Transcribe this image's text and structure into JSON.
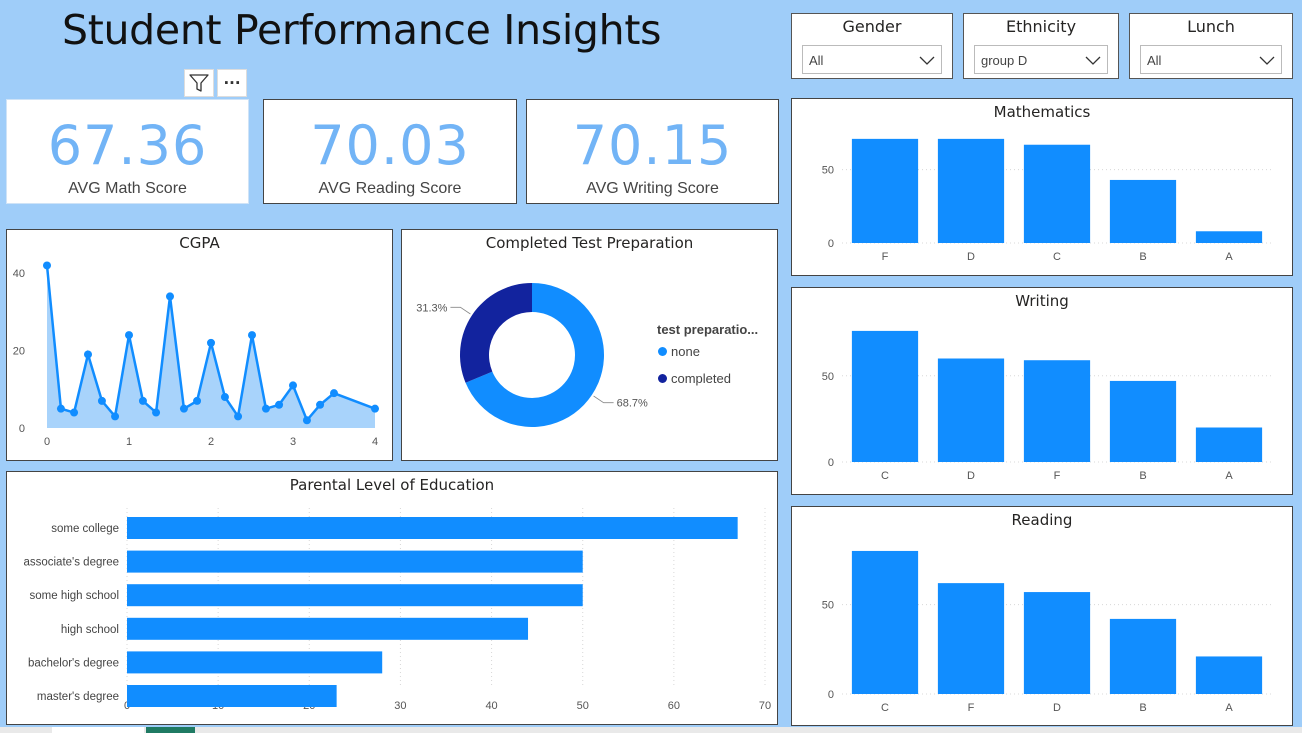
{
  "page": {
    "title": "Student Performance Insights"
  },
  "slicers": [
    {
      "label": "Gender",
      "value": "All"
    },
    {
      "label": "Ethnicity",
      "value": "group D"
    },
    {
      "label": "Lunch",
      "value": "All"
    }
  ],
  "visual_toolbar": {
    "filter_icon": "filter-icon",
    "more_icon": "more-options-icon",
    "more_glyph": "···"
  },
  "kpis": [
    {
      "value": "67.36",
      "label": "AVG Math Score"
    },
    {
      "value": "70.03",
      "label": "AVG Reading Score"
    },
    {
      "value": "70.15",
      "label": "AVG Writing Score"
    }
  ],
  "colors": {
    "bar": "#118dff",
    "dark": "#12239e",
    "kpi": "#72b4f6",
    "background": "#9fcdf9",
    "area": "#a8d3fb"
  },
  "chart_data": [
    {
      "id": "cgpa",
      "type": "area",
      "title": "CGPA",
      "x": [
        0,
        0.17,
        0.33,
        0.5,
        0.67,
        0.83,
        1,
        1.17,
        1.33,
        1.5,
        1.67,
        1.83,
        2,
        2.17,
        2.33,
        2.5,
        2.67,
        2.83,
        3,
        3.17,
        3.33,
        3.5,
        4
      ],
      "values": [
        42,
        5,
        4,
        19,
        7,
        3,
        24,
        7,
        4,
        34,
        5,
        7,
        22,
        8,
        3,
        24,
        5,
        6,
        11,
        2,
        6,
        9,
        5
      ],
      "xticks": [
        "0",
        "1",
        "2",
        "3",
        "4"
      ],
      "yticks": [
        "0",
        "20",
        "40"
      ],
      "xlim": [
        0,
        4
      ],
      "ylim": [
        0,
        46
      ]
    },
    {
      "id": "test-prep",
      "type": "pie",
      "title": "Completed Test Preparation",
      "legend_title": "test preparatio...",
      "legend_position": "right",
      "slices": [
        {
          "name": "none",
          "value": 68.7,
          "label": "68.7%",
          "color": "#118dff"
        },
        {
          "name": "completed",
          "value": 31.3,
          "label": "31.3%",
          "color": "#12239e"
        }
      ]
    },
    {
      "id": "parental-education",
      "type": "bar",
      "orientation": "horizontal",
      "title": "Parental Level of Education",
      "categories": [
        "some college",
        "associate's degree",
        "some high school",
        "high school",
        "bachelor's degree",
        "master's degree"
      ],
      "values": [
        67,
        50,
        50,
        44,
        28,
        23
      ],
      "xticks": [
        "0",
        "10",
        "20",
        "30",
        "40",
        "50",
        "60",
        "70"
      ],
      "xlim": [
        0,
        70
      ]
    },
    {
      "id": "mathematics",
      "type": "bar",
      "title": "Mathematics",
      "categories": [
        "F",
        "D",
        "C",
        "B",
        "A"
      ],
      "values": [
        71,
        71,
        67,
        43,
        8
      ],
      "yticks": [
        "0",
        "50"
      ],
      "ylim": [
        0,
        75
      ]
    },
    {
      "id": "writing",
      "type": "bar",
      "title": "Writing",
      "categories": [
        "C",
        "D",
        "F",
        "B",
        "A"
      ],
      "values": [
        76,
        60,
        59,
        47,
        20
      ],
      "yticks": [
        "0",
        "50"
      ],
      "ylim": [
        0,
        80
      ]
    },
    {
      "id": "reading",
      "type": "bar",
      "title": "Reading",
      "categories": [
        "C",
        "F",
        "D",
        "B",
        "A"
      ],
      "values": [
        80,
        62,
        57,
        42,
        21
      ],
      "yticks": [
        "0",
        "50"
      ],
      "ylim": [
        0,
        85
      ]
    }
  ]
}
